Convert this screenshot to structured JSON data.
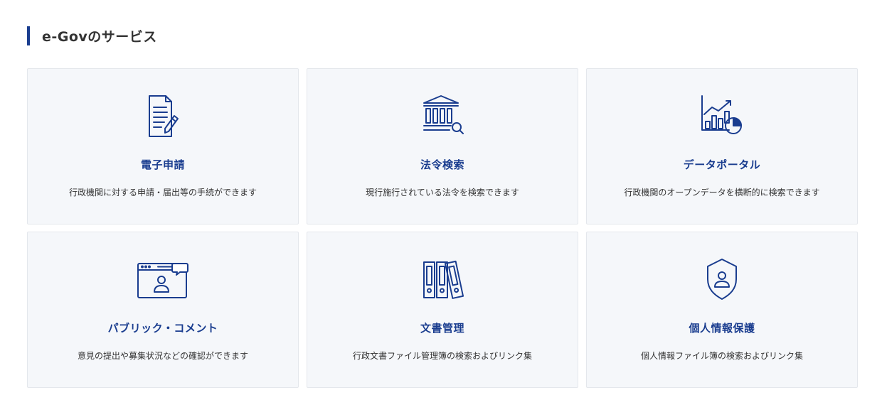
{
  "section": {
    "title": "e-Govのサービス"
  },
  "colors": {
    "accent": "#1a3d8f",
    "card_bg": "#f5f7fa",
    "card_border": "#e4e7ec"
  },
  "cards": [
    {
      "icon": "document-pen-icon",
      "title": "電子申請",
      "description": "行政機関に対する申請・届出等の手続ができます"
    },
    {
      "icon": "government-building-search-icon",
      "title": "法令検索",
      "description": "現行施行されている法令を検索できます"
    },
    {
      "icon": "chart-growth-icon",
      "title": "データポータル",
      "description": "行政機関のオープンデータを横断的に検索できます"
    },
    {
      "icon": "browser-comment-user-icon",
      "title": "パブリック・コメント",
      "description": "意見の提出や募集状況などの確認ができます"
    },
    {
      "icon": "binders-icon",
      "title": "文書管理",
      "description": "行政文書ファイル管理簿の検索およびリンク集"
    },
    {
      "icon": "shield-user-icon",
      "title": "個人情報保護",
      "description": "個人情報ファイル簿の検索およびリンク集"
    }
  ]
}
